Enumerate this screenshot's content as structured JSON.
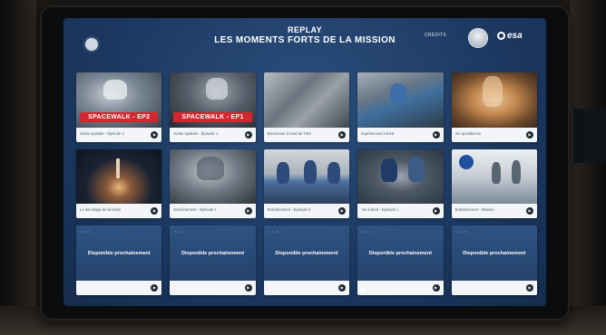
{
  "header": {
    "title_line1": "REPLAY",
    "title_line2": "LES MOMENTS FORTS DE LA MISSION",
    "credits": "CRÉDITS",
    "logo_text": "esa"
  },
  "cards": [
    {
      "banner": "SPACEWALK - EP2",
      "caption": "Sortie spatiale - Épisode 2"
    },
    {
      "banner": "SPACEWALK - EP1",
      "caption": "Sortie spatiale - Épisode 1"
    },
    {
      "caption": "Bienvenue à bord de l'ISS"
    },
    {
      "caption": "Expériences à bord"
    },
    {
      "caption": "Vie quotidienne"
    },
    {
      "caption": "Le décollage de la fusée"
    },
    {
      "caption": "Entraînement - Épisode 1"
    },
    {
      "caption": "Entraînement - Épisode 2"
    },
    {
      "caption": "Vie à bord - Épisode 1"
    },
    {
      "caption": "Entraînement - Mission"
    },
    {
      "soon": "Disponible prochainement"
    },
    {
      "soon": "Disponible prochainement"
    },
    {
      "soon": "Disponible prochainement"
    },
    {
      "soon": "Disponible prochainement"
    },
    {
      "soon": "Disponible prochainement"
    }
  ],
  "colors": {
    "accent": "#d3272f",
    "screen": "#1d3a63"
  }
}
